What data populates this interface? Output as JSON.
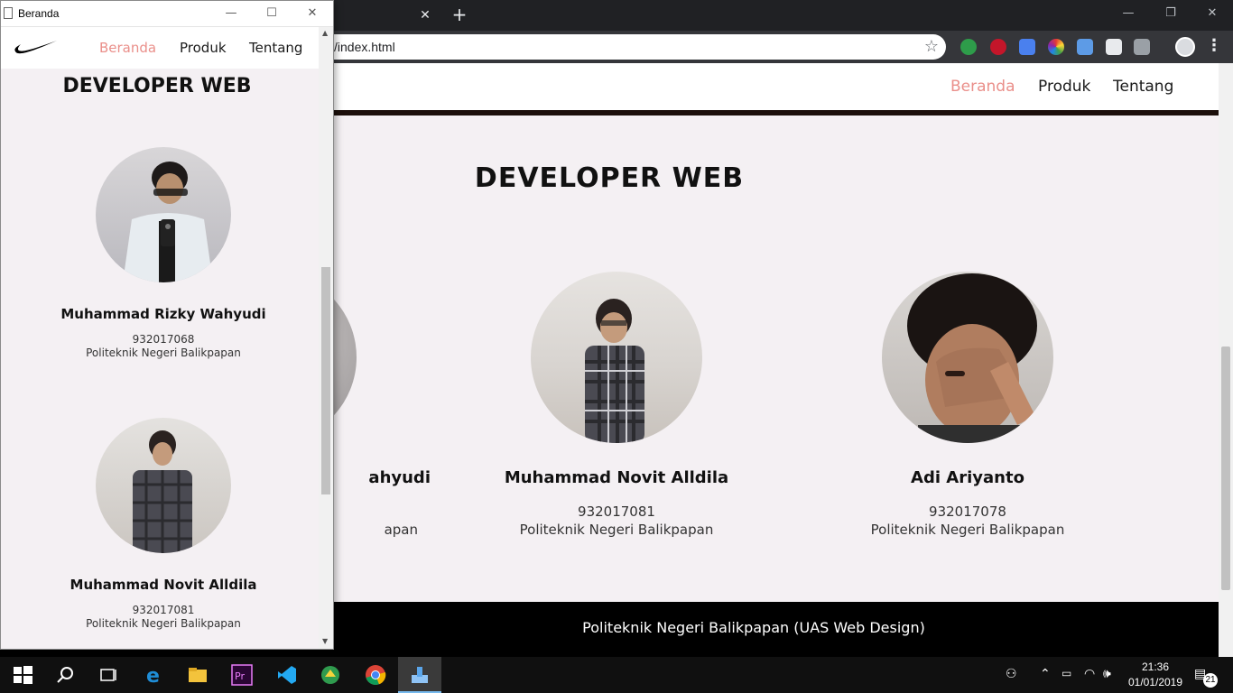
{
  "browser": {
    "url": "/index.html",
    "close_tab_glyph": "✕",
    "new_tab_glyph": "+"
  },
  "site": {
    "nav": {
      "home": "Beranda",
      "products": "Produk",
      "about": "Tentang"
    },
    "section_title": "DEVELOPER WEB",
    "developers": [
      {
        "name": "Muhammad Rizky Wahyudi",
        "nim": "932017068",
        "institution": "Politeknik Negeri Balikpapan"
      },
      {
        "name": "Muhammad Novit Alldila",
        "nim": "932017081",
        "institution": "Politeknik Negeri Balikpapan"
      },
      {
        "name": "Adi Ariyanto",
        "nim": "932017078",
        "institution": "Politeknik Negeri Balikpapan"
      }
    ],
    "partial_name_fragment": "ahyudi",
    "partial_inst_fragment": "apan",
    "footer": "Politeknik Negeri Balikpapan (UAS Web Design)",
    "accent_color": "#ea8f8a"
  },
  "popup": {
    "title": "Beranda"
  },
  "taskbar": {
    "time": "21:36",
    "date": "01/01/2019",
    "notifications": "21"
  }
}
